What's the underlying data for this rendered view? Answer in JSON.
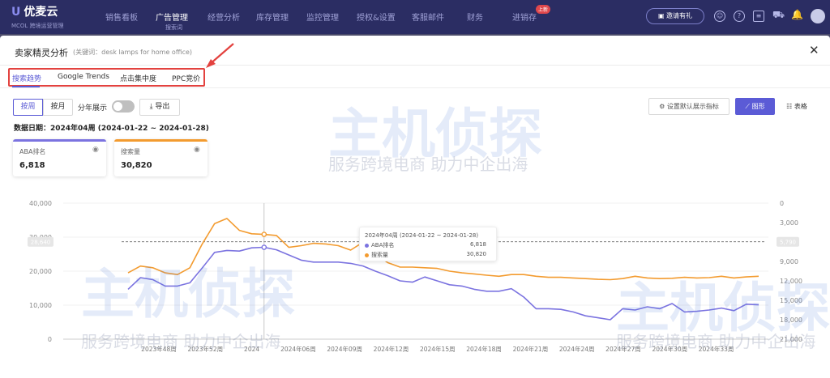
{
  "app": {
    "logo": "优麦云",
    "logo_sub": "MCOL 跨境运营管理"
  },
  "nav": [
    {
      "label": "销售看板"
    },
    {
      "label": "广告管理"
    },
    {
      "label": "经营分析"
    },
    {
      "label": "库存管理"
    },
    {
      "label": "监控管理"
    },
    {
      "label": "授权&设置"
    },
    {
      "label": "客服邮件"
    },
    {
      "label": "财务"
    },
    {
      "label": "进销存"
    }
  ],
  "nav_sub": "搜索词",
  "nav_badge": "上新",
  "topbar_button": "邀请有礼",
  "modal": {
    "title": "卖家精灵分析",
    "keyword": "(关键词：desk lamps for home office)"
  },
  "tabs": [
    {
      "label": "搜索趋势"
    },
    {
      "label": "Google Trends"
    },
    {
      "label": "点击集中度"
    },
    {
      "label": "PPC竞价"
    }
  ],
  "controls": {
    "by_week": "按周",
    "by_month": "按月",
    "by_year": "分年展示",
    "export": "导出",
    "set_default": "设置默认展示指标",
    "graph": "图形",
    "table": "表格"
  },
  "date_line": "数据日期：2024年04周 (2024-01-22 ~ 2024-01-28)",
  "cards": [
    {
      "label": "ABA排名",
      "value": "6,818",
      "color": "#7b73e0"
    },
    {
      "label": "搜索量",
      "value": "30,820",
      "color": "#f39b2f"
    }
  ],
  "tooltip": {
    "header": "2024年04周 (2024-01-22 ~ 2024-01-28)",
    "rows": [
      {
        "label": "ABA排名",
        "value": "6,818",
        "color": "#7b73e0"
      },
      {
        "label": "搜索量",
        "value": "30,820",
        "color": "#f39b2f"
      }
    ]
  },
  "watermark": {
    "brand": "主机侦探",
    "slogan": "服务跨境电商 助力中企出海"
  },
  "chart_data": {
    "type": "line",
    "x_ticks": [
      "2023年48周",
      "2023年52周",
      "2024",
      "2024年06周",
      "2024年09周",
      "2024年12周",
      "2024年15周",
      "2024年18周",
      "2024年21周",
      "2024年24周",
      "2024年27周",
      "2024年30周",
      "2024年33周"
    ],
    "y_left": {
      "ticks": [
        "0",
        "10,000",
        "20,000",
        "30,000",
        "40,000"
      ],
      "ylim": [
        0,
        40000
      ]
    },
    "y_right": {
      "ticks": [
        "0",
        "3,000",
        "6,000",
        "9,000",
        "12,000",
        "15,000",
        "18,000",
        "21,000"
      ],
      "ylim": [
        0,
        21000
      ],
      "inverted": true
    },
    "reference_labels": {
      "left": "28,640",
      "right": "5,790"
    },
    "series": [
      {
        "name": "搜索量",
        "axis": "left",
        "color": "#f39b2f",
        "values": [
          19500,
          21500,
          21000,
          19500,
          19000,
          21000,
          28000,
          34000,
          35500,
          32000,
          31000,
          30820,
          30500,
          27000,
          27500,
          28200,
          28000,
          27500,
          26200,
          28500,
          25000,
          22500,
          21200,
          21200,
          21000,
          20800,
          20000,
          19500,
          19200,
          18800,
          18500,
          19000,
          19000,
          18500,
          18200,
          18200,
          18000,
          17800,
          17600,
          17500,
          17800,
          18500,
          18000,
          17800,
          17900,
          18200,
          18000,
          18100,
          18500,
          18000,
          18300,
          18500
        ]
      },
      {
        "name": "ABA排名",
        "axis": "right",
        "color": "#7b73e0",
        "values": [
          13300,
          11500,
          11800,
          12800,
          12800,
          12300,
          10000,
          7600,
          7300,
          7400,
          6900,
          6818,
          7200,
          8000,
          8800,
          9100,
          9100,
          9100,
          9300,
          9700,
          10500,
          11200,
          12000,
          12200,
          11400,
          12000,
          12600,
          12800,
          13300,
          13600,
          13600,
          13200,
          14500,
          16300,
          16300,
          16400,
          16800,
          17400,
          17700,
          18000,
          16300,
          16500,
          16000,
          16300,
          15500,
          16800,
          16700,
          16500,
          16200,
          16600,
          15600,
          15700
        ]
      }
    ]
  }
}
